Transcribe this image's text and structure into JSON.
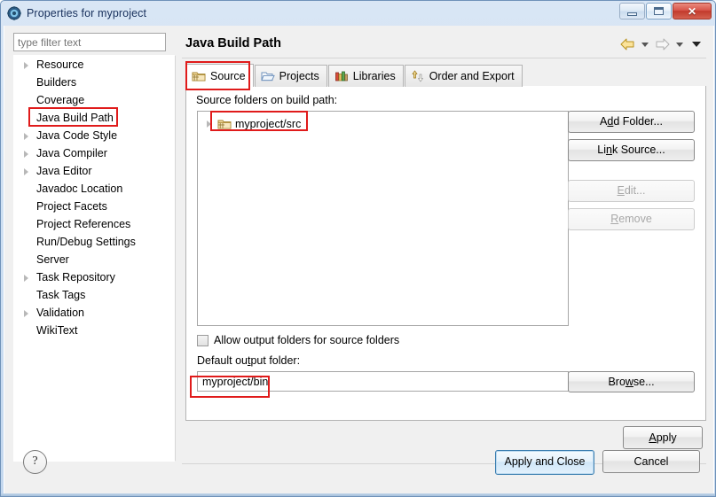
{
  "window": {
    "title": "Properties for myproject",
    "icon": "eclipse-properties-icon",
    "controls": {
      "minimize": "minimize-icon",
      "maximize": "maximize-icon",
      "close": "✕"
    }
  },
  "sidebar": {
    "filter": {
      "placeholder": "type filter text",
      "value": ""
    },
    "items": [
      {
        "label": "Resource",
        "expandable": true,
        "highlighted": false
      },
      {
        "label": "Builders",
        "expandable": false,
        "highlighted": false
      },
      {
        "label": "Coverage",
        "expandable": false,
        "highlighted": false
      },
      {
        "label": "Java Build Path",
        "expandable": false,
        "highlighted": true
      },
      {
        "label": "Java Code Style",
        "expandable": true,
        "highlighted": false
      },
      {
        "label": "Java Compiler",
        "expandable": true,
        "highlighted": false
      },
      {
        "label": "Java Editor",
        "expandable": true,
        "highlighted": false
      },
      {
        "label": "Javadoc Location",
        "expandable": false,
        "highlighted": false
      },
      {
        "label": "Project Facets",
        "expandable": false,
        "highlighted": false
      },
      {
        "label": "Project References",
        "expandable": false,
        "highlighted": false
      },
      {
        "label": "Run/Debug Settings",
        "expandable": false,
        "highlighted": false
      },
      {
        "label": "Server",
        "expandable": false,
        "highlighted": false
      },
      {
        "label": "Task Repository",
        "expandable": true,
        "highlighted": false
      },
      {
        "label": "Task Tags",
        "expandable": false,
        "highlighted": false
      },
      {
        "label": "Validation",
        "expandable": true,
        "highlighted": false
      },
      {
        "label": "WikiText",
        "expandable": false,
        "highlighted": false
      }
    ]
  },
  "page": {
    "title": "Java Build Path",
    "nav": {
      "back": "back-arrow-icon",
      "back_menu": "chevron-down-icon",
      "forward": "forward-arrow-icon",
      "forward_menu": "chevron-down-icon",
      "view_menu": "chevron-down-icon"
    },
    "tabs": [
      {
        "label": "Source",
        "icon": "source-folder-icon",
        "active": true,
        "highlighted": true
      },
      {
        "label": "Projects",
        "icon": "project-folder-icon",
        "active": false,
        "highlighted": false
      },
      {
        "label": "Libraries",
        "icon": "libraries-books-icon",
        "active": false,
        "highlighted": false
      },
      {
        "label": "Order and Export",
        "icon": "order-export-icon",
        "active": false,
        "highlighted": false
      }
    ],
    "source_tab": {
      "tree_label": "Source folders on build path:",
      "tree_label_mnemonic": "t",
      "entries": [
        {
          "label": "myproject/src",
          "icon": "source-folder-icon",
          "expandable": true,
          "highlighted": true
        }
      ],
      "buttons": [
        {
          "label": "Add Folder...",
          "mnemonic": "d",
          "enabled": true
        },
        {
          "label": "Link Source...",
          "mnemonic": "n",
          "enabled": true
        },
        {
          "label": "Edit...",
          "mnemonic": "E",
          "enabled": false
        },
        {
          "label": "Remove",
          "mnemonic": "R",
          "enabled": false
        }
      ],
      "allow_output_checkbox": {
        "label": "Allow output folders for source folders",
        "checked": false
      },
      "default_output_label": "Default output folder:",
      "default_output_value": "myproject/bin",
      "browse_label": "Browse...",
      "browse_mnemonic": "w",
      "apply_label": "Apply",
      "apply_mnemonic": "A"
    }
  },
  "footer": {
    "help": "?",
    "apply_and_close": "Apply and Close",
    "cancel": "Cancel"
  },
  "annotations": {
    "color": "#e01b1b",
    "boxes": [
      "java-build-path-nav-item",
      "source-tab",
      "myproject-src-entry",
      "default-output-folder-value"
    ]
  }
}
